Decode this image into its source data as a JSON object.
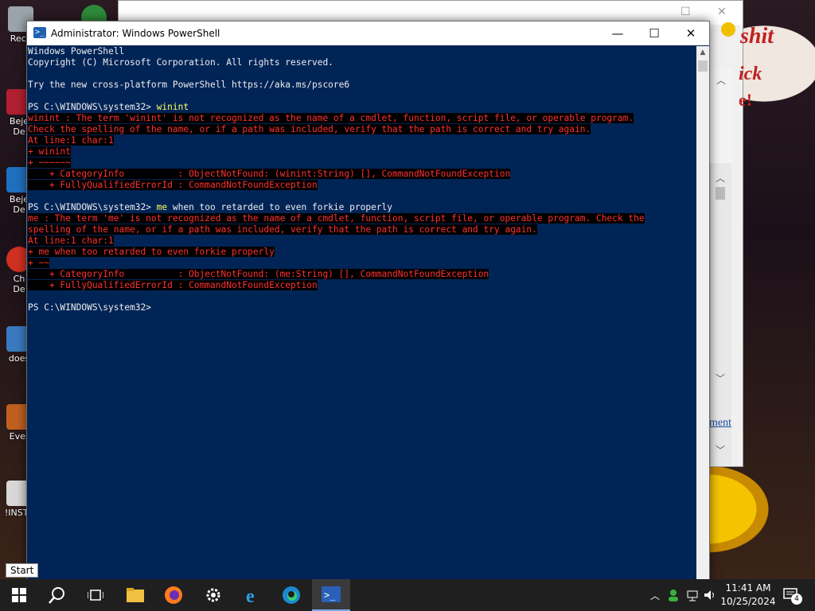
{
  "window": {
    "title": "Administrator: Windows PowerShell",
    "minimize": "—",
    "maximize": "☐",
    "close": "✕"
  },
  "console": {
    "lines": [
      {
        "text": "Windows PowerShell",
        "type": "out"
      },
      {
        "text": "Copyright (C) Microsoft Corporation. All rights reserved.",
        "type": "out"
      },
      {
        "text": "",
        "type": "out"
      },
      {
        "text": "Try the new cross-platform PowerShell https://aka.ms/pscore6",
        "type": "out"
      },
      {
        "text": "",
        "type": "out"
      },
      {
        "prompt": "PS C:\\WINDOWS\\system32> ",
        "cmd": "winint",
        "rest": "",
        "type": "prompt"
      },
      {
        "text": "winint : The term 'winint' is not recognized as the name of a cmdlet, function, script file, or operable program.",
        "type": "err"
      },
      {
        "text": "Check the spelling of the name, or if a path was included, verify that the path is correct and try again.",
        "type": "err"
      },
      {
        "text": "At line:1 char:1",
        "type": "err"
      },
      {
        "text": "+ winint",
        "type": "err"
      },
      {
        "text": "+ ~~~~~~",
        "type": "err"
      },
      {
        "text": "    + CategoryInfo          : ObjectNotFound: (winint:String) [], CommandNotFoundException",
        "type": "err"
      },
      {
        "text": "    + FullyQualifiedErrorId : CommandNotFoundException",
        "type": "err"
      },
      {
        "text": "",
        "type": "out"
      },
      {
        "prompt": "PS C:\\WINDOWS\\system32> ",
        "cmd": "me",
        "rest": " when too retarded to even forkie properly",
        "type": "prompt"
      },
      {
        "text": "me : The term 'me' is not recognized as the name of a cmdlet, function, script file, or operable program. Check the",
        "type": "err"
      },
      {
        "text": "spelling of the name, or if a path was included, verify that the path is correct and try again.",
        "type": "err"
      },
      {
        "text": "At line:1 char:1",
        "type": "err"
      },
      {
        "text": "+ me when too retarded to even forkie properly",
        "type": "err"
      },
      {
        "text": "+ ~~",
        "type": "err"
      },
      {
        "text": "    + CategoryInfo          : ObjectNotFound: (me:String) [], CommandNotFoundException",
        "type": "err"
      },
      {
        "text": "    + FullyQualifiedErrorId : CommandNotFoundException",
        "type": "err"
      },
      {
        "text": "",
        "type": "out"
      },
      {
        "prompt": "PS C:\\WINDOWS\\system32>",
        "cmd": "",
        "rest": "",
        "type": "prompt"
      }
    ]
  },
  "desktop_icons": [
    {
      "label": "Recy",
      "name": "recycle-bin-icon"
    },
    {
      "label": "Beje",
      "name": "desktop-shortcut-icon"
    },
    {
      "label": "De",
      "name": "desktop-shortcut-icon"
    },
    {
      "label": "Beje",
      "name": "desktop-shortcut-icon"
    },
    {
      "label": "De",
      "name": "desktop-shortcut-icon"
    },
    {
      "label": "Ch",
      "name": "desktop-shortcut-icon"
    },
    {
      "label": "De",
      "name": "desktop-shortcut-icon"
    },
    {
      "label": "does",
      "name": "desktop-shortcut-icon"
    },
    {
      "label": "Ever",
      "name": "desktop-shortcut-icon"
    },
    {
      "label": "!INSTA",
      "name": "desktop-shortcut-icon"
    }
  ],
  "background": {
    "sign_text_1": "shit",
    "sign_text_2": "ick",
    "sign_text_3": "e!",
    "link_text": "ment"
  },
  "tooltip": "Start",
  "taskbar": {
    "items": [
      "start-button",
      "search-button",
      "task-view-button",
      "file-explorer",
      "firefox",
      "settings",
      "internet-explorer",
      "edge",
      "powershell"
    ],
    "notification_count": "4"
  },
  "clock": {
    "time": "11:41 AM",
    "date": "10/25/2024"
  },
  "colors": {
    "console_bg": "#012456",
    "error_fg": "#ff3030",
    "command_fg": "#ffff60",
    "taskbar_bg": "#1f1f1f"
  }
}
